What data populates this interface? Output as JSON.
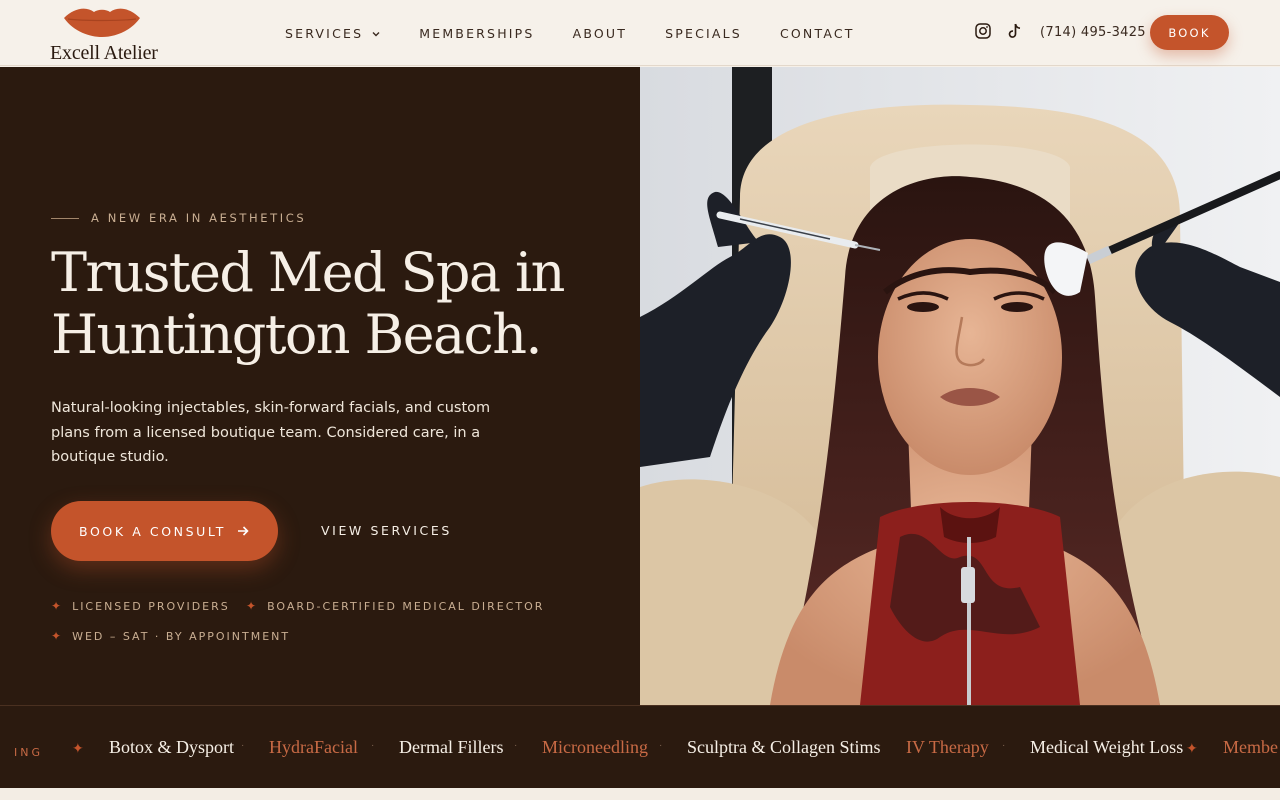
{
  "brand": {
    "name": "Excell Atelier",
    "lips_color": "#c4542b"
  },
  "nav": {
    "items": [
      "SERVICES",
      "MEMBERSHIPS",
      "ABOUT",
      "SPECIALS",
      "CONTACT"
    ],
    "services_has_dropdown": true
  },
  "header": {
    "social_icons": [
      "instagram-icon",
      "tiktok-icon"
    ],
    "phone": "(714) 495-3425",
    "book_label": "BOOK"
  },
  "hero": {
    "eyebrow": "A NEW ERA IN AESTHETICS",
    "headline_line1": "Trusted Med Spa in",
    "headline_line2": "Huntington Beach.",
    "subcopy": "Natural-looking injectables, skin-forward facials, and custom plans from a licensed boutique team. Considered care, in a boutique studio.",
    "cta_label": "BOOK A CONSULT",
    "secondary_label": "VIEW SERVICES",
    "badges": [
      "LICENSED PROVIDERS",
      "BOARD-CERTIFIED MEDICAL DIRECTOR",
      "WED – SAT · BY APPOINTMENT"
    ],
    "image_alt": "Med spa client receiving treatment"
  },
  "marquee": {
    "leading_fragment": "ING",
    "items": [
      "Botox & Dysport",
      "HydraFacial",
      "Dermal Fillers",
      "Microneedling",
      "Sculptra & Collagen Stims",
      "IV Therapy",
      "Medical Weight Loss",
      "Membe"
    ]
  },
  "colors": {
    "accent": "#c4542b",
    "dark": "#2b1a0f",
    "cream": "#f6f1ea"
  }
}
